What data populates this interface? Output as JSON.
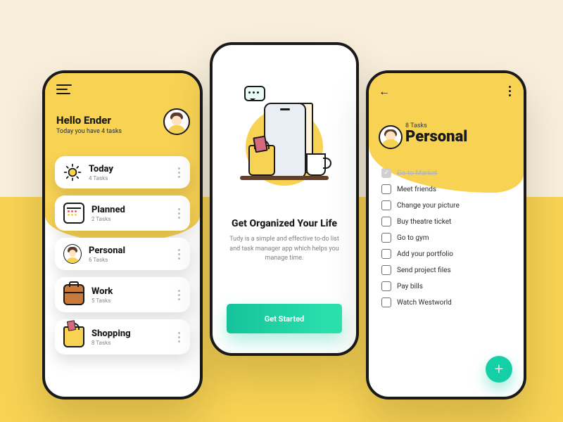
{
  "home": {
    "greeting_title": "Hello Ender",
    "greeting_subtitle": "Today you have 4 tasks",
    "categories": [
      {
        "icon": "sun-icon",
        "title": "Today",
        "subtitle": "4 Tasks"
      },
      {
        "icon": "calendar-icon",
        "title": "Planned",
        "subtitle": "2 Tasks"
      },
      {
        "icon": "person-icon",
        "title": "Personal",
        "subtitle": "6 Tasks"
      },
      {
        "icon": "briefcase-icon",
        "title": "Work",
        "subtitle": "5 Tasks"
      },
      {
        "icon": "shopping-bag-icon",
        "title": "Shopping",
        "subtitle": "8 Tasks"
      }
    ]
  },
  "onboarding": {
    "headline": "Get Organized Your Life",
    "description": "Tudy is a simple and effective to-do list and task manager app which helps you manage time.",
    "cta": "Get Started"
  },
  "personal": {
    "count_label": "8 Tasks",
    "title": "Personal",
    "tasks": [
      {
        "label": "Go to Market",
        "done": true
      },
      {
        "label": "Meet friends",
        "done": false
      },
      {
        "label": "Change your picture",
        "done": false
      },
      {
        "label": "Buy theatre ticket",
        "done": false
      },
      {
        "label": "Go to gym",
        "done": false
      },
      {
        "label": "Add your portfolio",
        "done": false
      },
      {
        "label": "Send project files",
        "done": false
      },
      {
        "label": "Pay bills",
        "done": false
      },
      {
        "label": "Watch Westworld",
        "done": false
      }
    ]
  }
}
